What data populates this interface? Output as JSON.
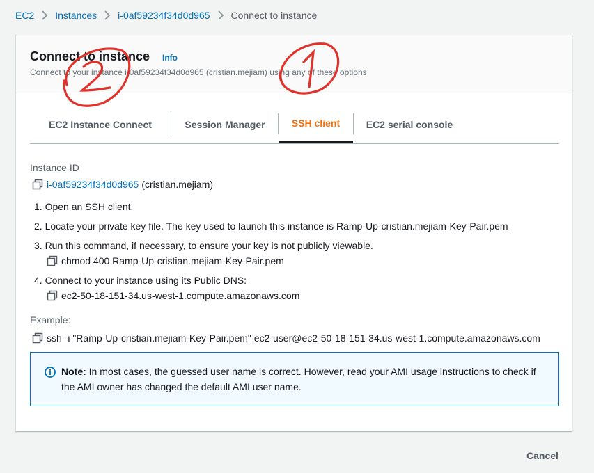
{
  "breadcrumb": {
    "items": [
      "EC2",
      "Instances",
      "i-0af59234f34d0d965"
    ],
    "current": "Connect to instance"
  },
  "header": {
    "title": "Connect to instance",
    "info": "Info",
    "subtitle": "Connect to your instance i-0af59234f34d0d965 (cristian.mejiam) using any of these options"
  },
  "tabs": [
    {
      "label": "EC2 Instance Connect",
      "active": false
    },
    {
      "label": "Session Manager",
      "active": false
    },
    {
      "label": "SSH client",
      "active": true
    },
    {
      "label": "EC2 serial console",
      "active": false
    }
  ],
  "instance": {
    "label": "Instance ID",
    "id": "i-0af59234f34d0d965",
    "name": "(cristian.mejiam)"
  },
  "steps": {
    "s1": "1. Open an SSH client.",
    "s2": "2. Locate your private key file. The key used to launch this instance is Ramp-Up-cristian.mejiam-Key-Pair.pem",
    "s3": "3. Run this command, if necessary, to ensure your key is not publicly viewable.",
    "s3_cmd": "chmod 400 Ramp-Up-cristian.mejiam-Key-Pair.pem",
    "s4": "4. Connect to your instance using its Public DNS:",
    "s4_cmd": "ec2-50-18-151-34.us-west-1.compute.amazonaws.com"
  },
  "example": {
    "label": "Example:",
    "command": "ssh -i \"Ramp-Up-cristian.mejiam-Key-Pair.pem\" ec2-user@ec2-50-18-151-34.us-west-1.compute.amazonaws.com"
  },
  "note": {
    "bold": "Note:",
    "text": " In most cases, the guessed user name is correct. However, read your AMI usage instructions to check if the AMI owner has changed the default AMI user name."
  },
  "footer": {
    "cancel": "Cancel"
  },
  "annotations": [
    "2",
    "1"
  ],
  "colors": {
    "accent_orange": "#ec7211",
    "link_blue": "#0073bb",
    "annotation_red": "#e0322b"
  }
}
